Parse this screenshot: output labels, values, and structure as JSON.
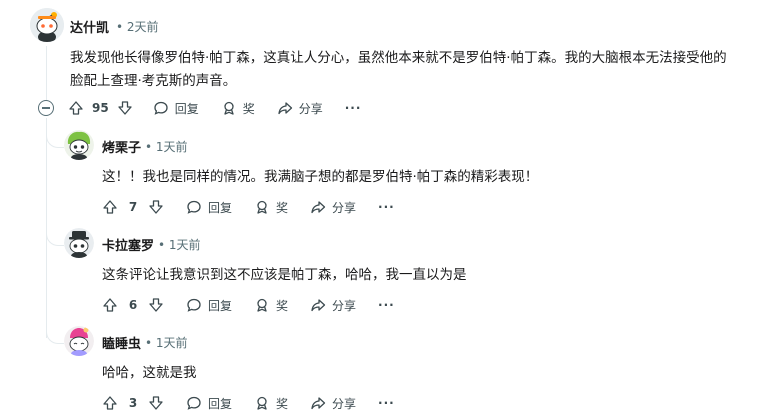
{
  "comments": [
    {
      "username": "达什凯",
      "age": "2天前",
      "text_line1": "我发现他长得像罗伯特·帕丁森，这真让人分心，虽然他本来就不是罗伯特·帕丁森。我的大脑根本无法接受他的",
      "text_line2": "脸配上查理·考克斯的声音。",
      "votes": "95",
      "reply_label": "回复",
      "award_label": "奖",
      "share_label": "分享",
      "more_label": "···"
    },
    {
      "username": "烤栗子",
      "age": "1天前",
      "text_line1": "这！！我也是同样的情况。我满脑子想的都是罗伯特·帕丁森的精彩表现！",
      "votes": "7",
      "reply_label": "回复",
      "award_label": "奖",
      "share_label": "分享",
      "more_label": "···"
    },
    {
      "username": "卡拉塞罗",
      "age": "1天前",
      "text_line1": "这条评论让我意识到这不应该是帕丁森，哈哈，我一直以为是",
      "votes": "6",
      "reply_label": "回复",
      "award_label": "奖",
      "share_label": "分享",
      "more_label": "···"
    },
    {
      "username": "瞌睡虫",
      "age": "1天前",
      "text_line1": "哈哈，这就是我",
      "votes": "3",
      "reply_label": "回复",
      "award_label": "奖",
      "share_label": "分享",
      "more_label": "···"
    }
  ],
  "separator": "•",
  "icons": [
    "upvote-icon",
    "downvote-icon",
    "comment-bubble-icon",
    "award-icon",
    "share-arrow-icon",
    "more-icon",
    "collapse-icon"
  ]
}
